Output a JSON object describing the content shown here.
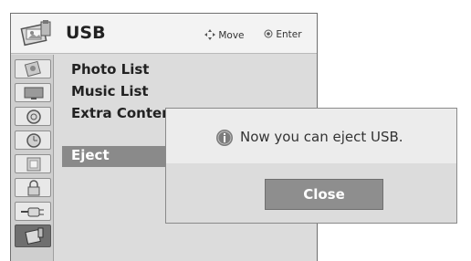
{
  "header": {
    "title": "USB",
    "hint_move": "Move",
    "hint_enter": "Enter"
  },
  "sidebar": {
    "items": [
      {
        "icon": "picture-icon"
      },
      {
        "icon": "monitor-icon"
      },
      {
        "icon": "disc-icon"
      },
      {
        "icon": "clock-icon"
      },
      {
        "icon": "frame-icon"
      },
      {
        "icon": "lock-icon"
      },
      {
        "icon": "plug-icon"
      },
      {
        "icon": "usb-media-icon",
        "active": true
      }
    ]
  },
  "menu": {
    "items": [
      "Photo List",
      "Music List",
      "Extra Content",
      "Eject"
    ],
    "selected": "Eject"
  },
  "dialog": {
    "message": "Now you can eject USB.",
    "close_label": "Close"
  },
  "colors": {
    "selection": "#8a8a8a",
    "header_bg": "#f3f3f3",
    "panel_bg": "#dcdcdc"
  }
}
